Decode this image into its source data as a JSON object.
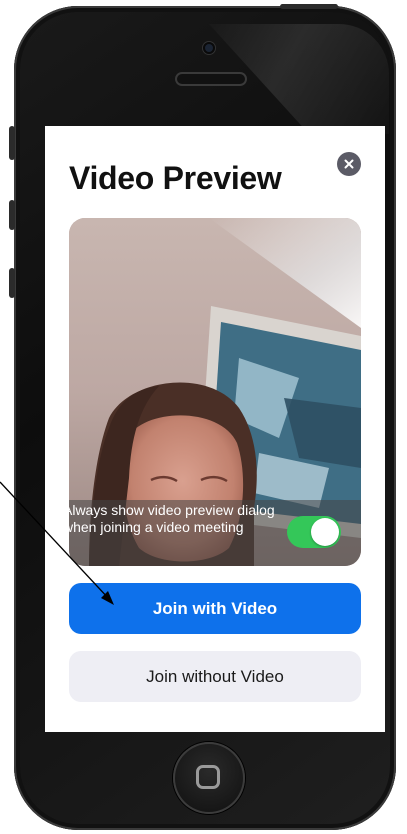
{
  "dialog": {
    "title": "Video Preview",
    "close_icon": "close-icon"
  },
  "preview": {
    "overlay_text": "Always show video preview dialog when joining a video meeting",
    "toggle_on": true,
    "toggle_color": "#34c759"
  },
  "buttons": {
    "join_with_video": "Join with Video",
    "join_without_video": "Join without Video"
  },
  "colors": {
    "primary": "#0e71eb",
    "secondary_bg": "#eeeef4",
    "close_bg": "#5b5b66"
  }
}
